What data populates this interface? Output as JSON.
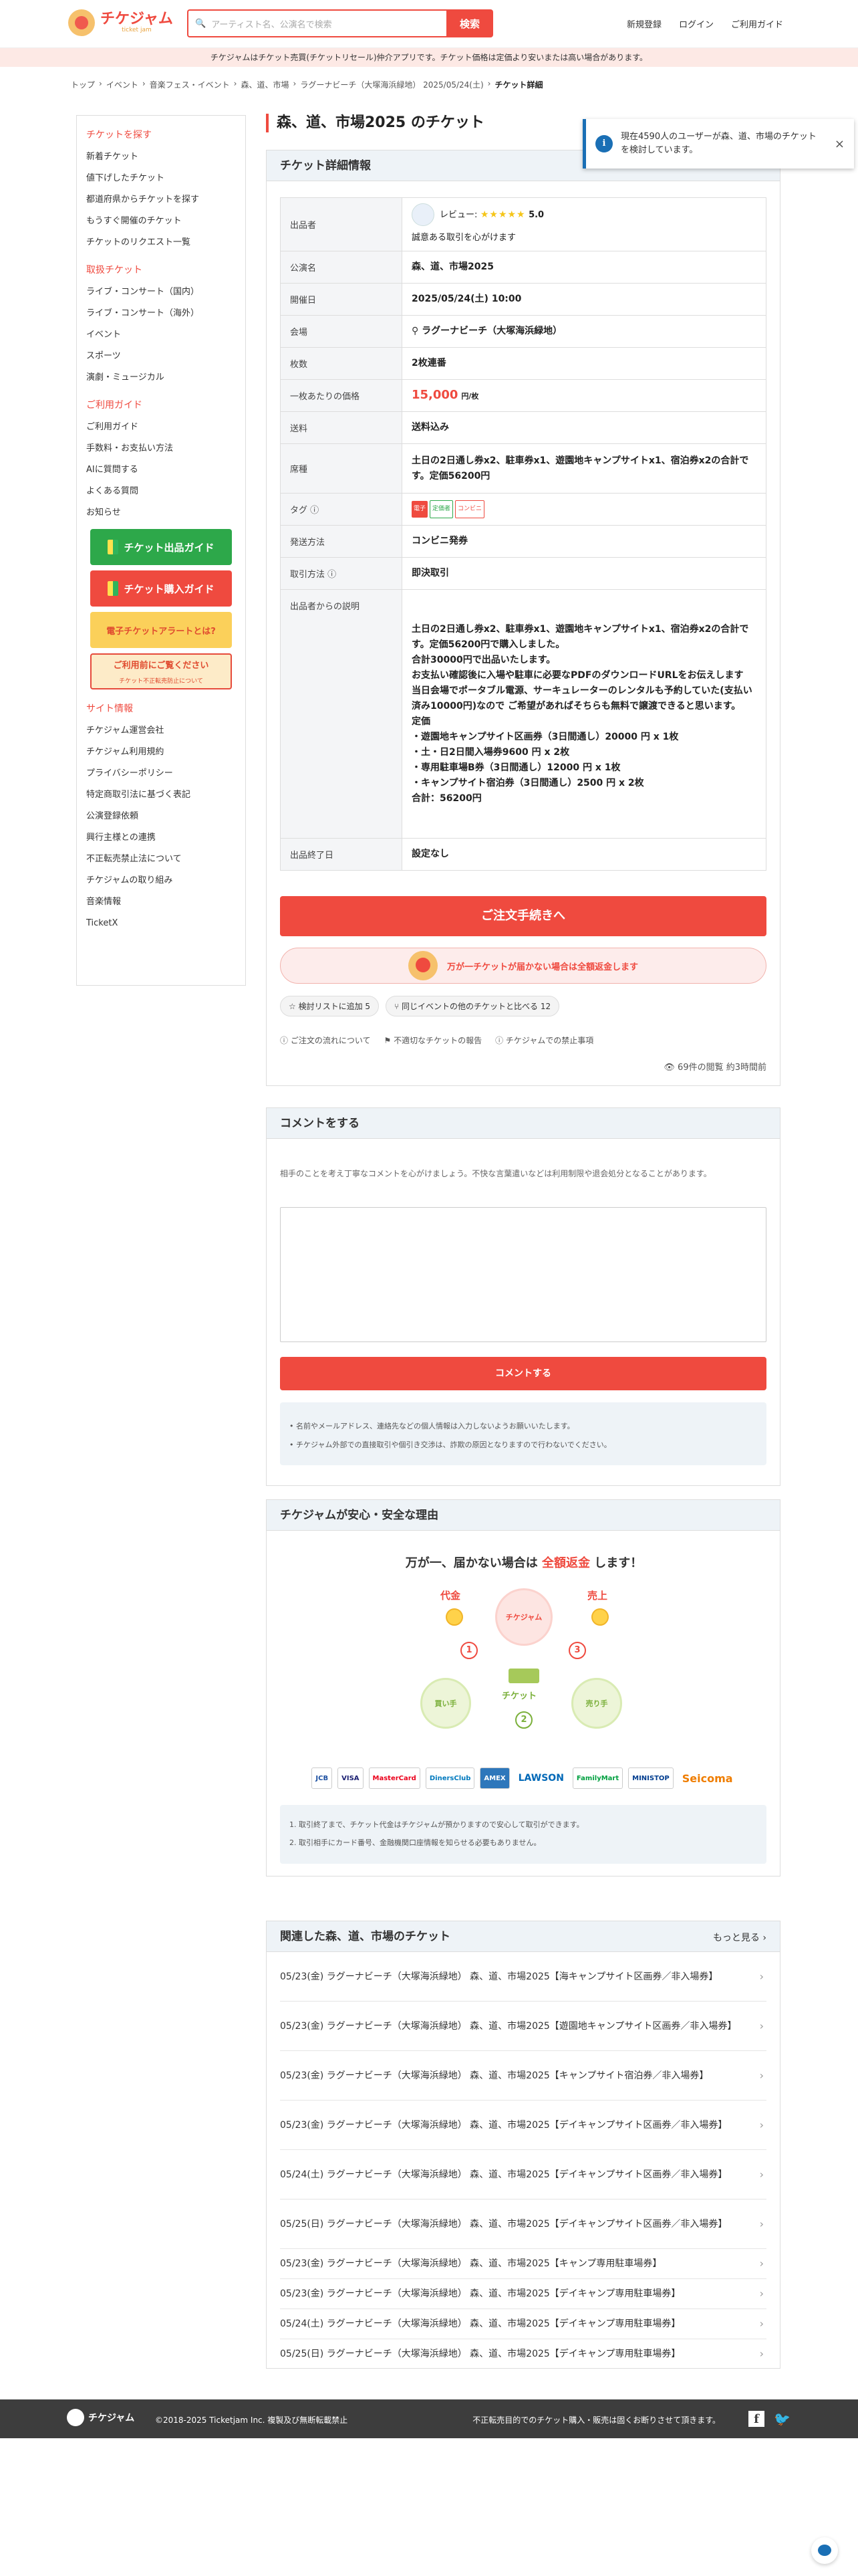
{
  "header": {
    "logo_text": "チケジャム",
    "logo_sub": "ticket jam",
    "search_placeholder": "アーティスト名、公演名で検索",
    "search_button": "検索",
    "links": [
      "新規登録",
      "ログイン",
      "ご利用ガイド"
    ]
  },
  "notice_bar": "チケジャムはチケット売買(チケットリセール)仲介アプリです。チケット価格は定価より安いまたは高い場合があります。",
  "breadcrumb": [
    "トップ",
    "イベント",
    "音楽フェス・イベント",
    "森、道、市場",
    "ラグーナビーチ（大塚海浜緑地） 2025/05/24(土)",
    "チケット詳細"
  ],
  "sidebar": {
    "sections": [
      {
        "title": "チケットを探す",
        "items": [
          "新着チケット",
          "値下げしたチケット",
          "都道府県からチケットを探す",
          "もうすぐ開催のチケット",
          "チケットのリクエスト一覧"
        ]
      },
      {
        "title": "取扱チケット",
        "items": [
          "ライブ・コンサート（国内）",
          "ライブ・コンサート（海外）",
          "イベント",
          "スポーツ",
          "演劇・ミュージカル"
        ]
      },
      {
        "title": "ご利用ガイド",
        "items": [
          "ご利用ガイド",
          "手数料・お支払い方法",
          "AIに質問する",
          "よくある質問",
          "お知らせ"
        ]
      }
    ],
    "banners": [
      "チケット出品ガイド",
      "チケット購入ガイド",
      "電子チケットアラートとは?",
      "ご利用前にご覧ください",
      "チケット不正転売防止について"
    ],
    "site_info_title": "サイト情報",
    "site_info_items": [
      "チケジャム運営会社",
      "チケジャム利用規約",
      "プライバシーポリシー",
      "特定商取引法に基づく表記",
      "公演登録依頼",
      "興行主様との連携",
      "不正転売禁止法について",
      "チケジャムの取り組み",
      "音楽情報",
      "TicketX"
    ]
  },
  "page_title": "森、道、市場2025 のチケット",
  "toast": {
    "icon": "i",
    "message": "現在4590人のユーザーが森、道、市場のチケットを検討しています。",
    "close": "×"
  },
  "detail": {
    "heading": "チケット詳細情報",
    "rows": {
      "seller_label": "出品者",
      "seller_name": "レビュー:",
      "seller_stars": "★★★★★",
      "seller_rating": "5.0",
      "seller_note": "誠意ある取引を心がけます",
      "event_label": "公演名",
      "event_value": "森、道、市場2025",
      "date_label": "開催日",
      "date_value": "2025/05/24(土) 10:00",
      "venue_label": "会場",
      "venue_value": "ラグーナビーチ（大塚海浜緑地）",
      "count_label": "枚数",
      "count_value": "2枚連番",
      "price_label": "一枚あたりの価格",
      "price_value": "15,000",
      "price_unit": "円/枚",
      "shipping_label": "送料",
      "shipping_value": "送料込み",
      "seat_label": "席種",
      "seat_value": "土日の2日通し券x2、駐車券x1、遊園地キャンプサイトx1、宿泊券x2の合計です。定価56200円",
      "tag_label": "タグ",
      "tags": [
        "電子",
        "定価者",
        "コンビニ"
      ],
      "delivery_label": "発送方法",
      "delivery_value": "コンビニ発券",
      "method_label": "取引方法",
      "method_value": "即決取引",
      "desc_label": "出品者からの説明",
      "desc_lines": [
        "土日の2日通し券x2、駐車券x1、遊園地キャンプサイトx1、宿泊券x2の合計です。定価56200円で購入しました。",
        "合計30000円で出品いたします。",
        "お支払い確認後に入場や駐車に必要なPDFのダウンロードURLをお伝えします",
        "当日会場でポータブル電源、サーキュレーターのレンタルも予約していた(支払い済み10000円)なので ご希望があればそちらも無料で譲渡できると思います。",
        "定価",
        "・遊園地キャンプサイト区画券（3日間通し）20000 円 x 1枚",
        "・土・日2日間入場券9600 円 x 2枚",
        "・専用駐車場B券（3日間通し）12000 円 x 1枚",
        "・キャンプサイト宿泊券（3日間通し）2500 円 x 2枚",
        "合計：56200円"
      ],
      "end_label": "出品終了日",
      "end_value": "設定なし"
    },
    "order_button": "ご注文手続きへ",
    "refund_text": "万が一チケットが届かない場合は全額返金します",
    "chips": [
      "検討リストに追加 5",
      "同じイベントの他のチケットと比べる 12"
    ],
    "links": [
      "ご注文の流れについて",
      "不適切なチケットの報告",
      "チケジャムでの禁止事項"
    ],
    "stats": "69件の閲覧 約3時間前"
  },
  "comment": {
    "heading": "コメントをする",
    "note": "相手のことを考え丁寧なコメントを心がけましょう。不快な言葉遣いなどは利用制限や退会処分となることがあります。",
    "button": "コメントする",
    "info": [
      "名前やメールアドレス、連絡先などの個人情報は入力しないようお願いいたします。",
      "チケジャム外部での直接取引や個引き交渉は、詐欺の原因となりますので行わないでください。"
    ]
  },
  "safety": {
    "heading": "チケジャムが安心・安全な理由",
    "tagline_1": "万が一、届かない場合は",
    "tagline_2": "全額返金",
    "tagline_3": "します！",
    "label_price": "代金",
    "label_sales": "売上",
    "label_ticket": "チケット",
    "label_buyer": "買い手",
    "label_seller": "売り手",
    "center": "チケジャム",
    "steps": [
      "1",
      "2",
      "3"
    ],
    "payments": [
      "JCB",
      "VISA",
      "MasterCard",
      "DinersClub",
      "AMEX",
      "LAWSON",
      "FamilyMart",
      "MINISTOP",
      "Seicoma"
    ],
    "notes": [
      "1. 取引終了まで、チケット代金はチケジャムが預かりますので安心して取引ができます。",
      "2. 取引相手にカード番号、金融機関口座情報を知らせる必要もありません。"
    ]
  },
  "related": {
    "heading": "関連した森、道、市場のチケット",
    "more": "もっと見る",
    "items": [
      "05/23(金) ラグーナビーチ（大塚海浜緑地） 森、道、市場2025【海キャンプサイト区画券／非入場券】",
      "05/23(金) ラグーナビーチ（大塚海浜緑地） 森、道、市場2025【遊園地キャンプサイト区画券／非入場券】",
      "05/23(金) ラグーナビーチ（大塚海浜緑地） 森、道、市場2025【キャンプサイト宿泊券／非入場券】",
      "05/23(金) ラグーナビーチ（大塚海浜緑地） 森、道、市場2025【デイキャンプサイト区画券／非入場券】",
      "05/24(土) ラグーナビーチ（大塚海浜緑地） 森、道、市場2025【デイキャンプサイト区画券／非入場券】",
      "05/25(日) ラグーナビーチ（大塚海浜緑地） 森、道、市場2025【デイキャンプサイト区画券／非入場券】",
      "05/23(金) ラグーナビーチ（大塚海浜緑地） 森、道、市場2025【キャンプ専用駐車場券】",
      "05/23(金) ラグーナビーチ（大塚海浜緑地） 森、道、市場2025【デイキャンプ専用駐車場券】",
      "05/24(土) ラグーナビーチ（大塚海浜緑地） 森、道、市場2025【デイキャンプ専用駐車場券】",
      "05/25(日) ラグーナビーチ（大塚海浜緑地） 森、道、市場2025【デイキャンプ専用駐車場券】"
    ]
  },
  "footer": {
    "logo": "チケジャム",
    "copyright": "©2018-2025 Ticketjam Inc. 複製及び無断転載禁止",
    "notice": "不正転売目的でのチケット購入・販売は固くお断りさせて頂きます。",
    "fb": "f",
    "tw": "🐦"
  },
  "colors": {
    "accent": "#ef4a3f",
    "link": "#1a6fb5",
    "panel": "#eef3f7"
  }
}
